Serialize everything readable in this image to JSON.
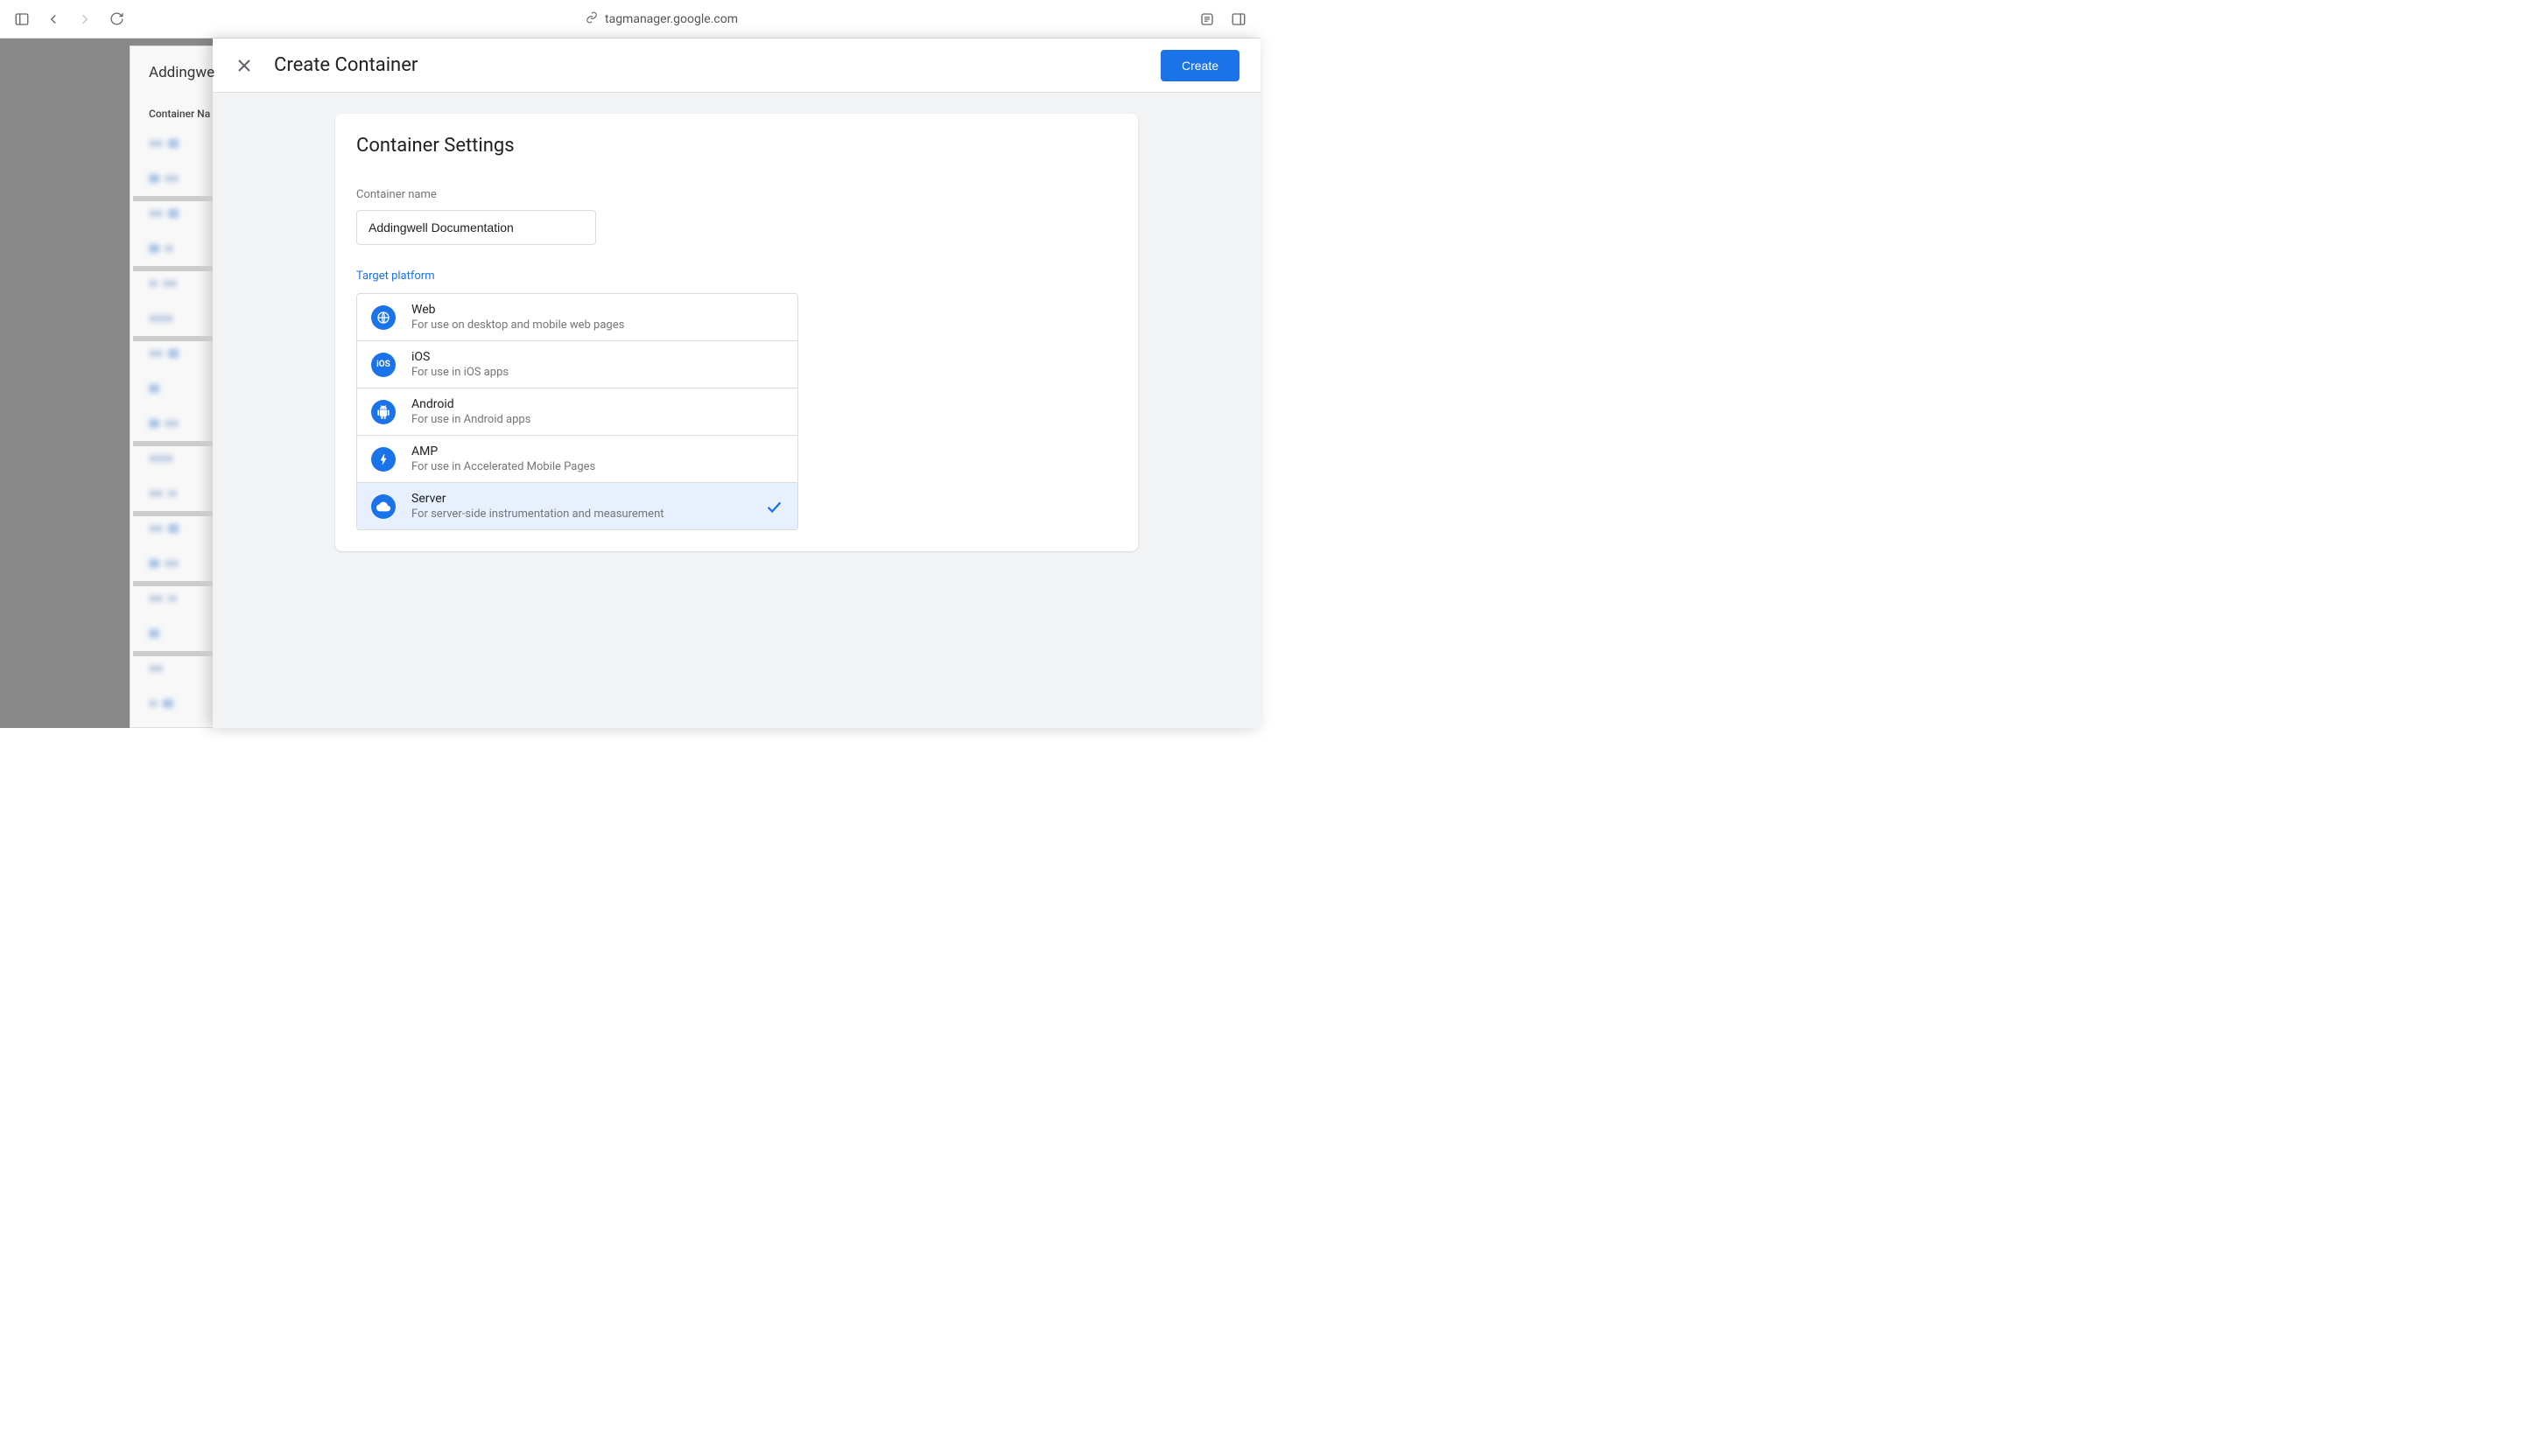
{
  "browser": {
    "url": "tagmanager.google.com"
  },
  "background": {
    "account_name": "Addingwe",
    "column_header": "Container Na"
  },
  "panel": {
    "title": "Create Container",
    "create_button": "Create"
  },
  "settings": {
    "card_title": "Container Settings",
    "name_label": "Container name",
    "name_value": "Addingwell Documentation",
    "target_label": "Target platform",
    "platforms": [
      {
        "name": "Web",
        "desc": "For use on desktop and mobile web pages",
        "selected": false
      },
      {
        "name": "iOS",
        "desc": "For use in iOS apps",
        "selected": false
      },
      {
        "name": "Android",
        "desc": "For use in Android apps",
        "selected": false
      },
      {
        "name": "AMP",
        "desc": "For use in Accelerated Mobile Pages",
        "selected": false
      },
      {
        "name": "Server",
        "desc": "For server-side instrumentation and measurement",
        "selected": true
      }
    ]
  }
}
